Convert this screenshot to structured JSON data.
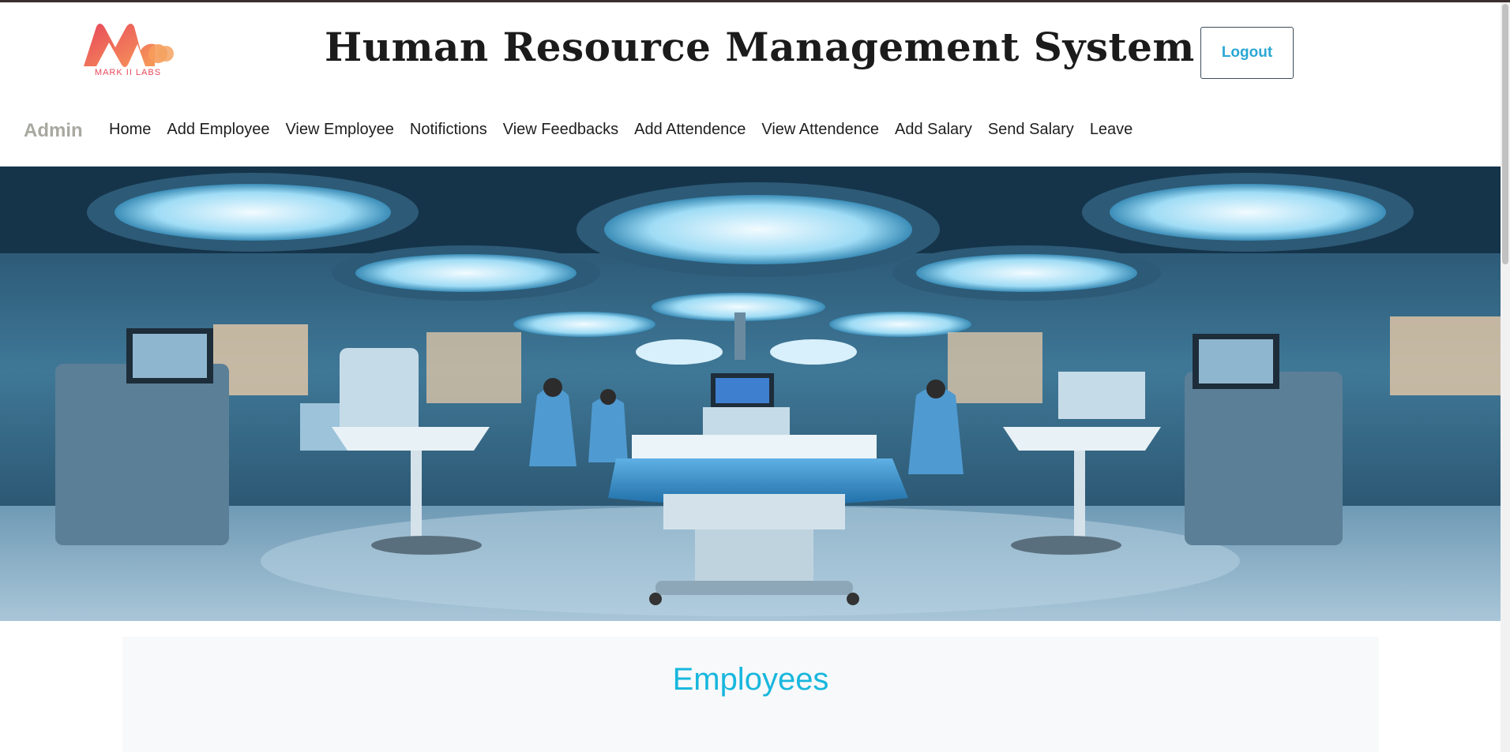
{
  "header": {
    "logo_text": "MARK II LABS",
    "title": "Human Resource Management System",
    "logout_label": "Logout"
  },
  "nav": {
    "brand": "Admin",
    "items": [
      {
        "label": "Home"
      },
      {
        "label": "Add Employee"
      },
      {
        "label": "View Employee"
      },
      {
        "label": "Notifictions"
      },
      {
        "label": "View Feedbacks"
      },
      {
        "label": "Add Attendence"
      },
      {
        "label": "View Attendence"
      },
      {
        "label": "Add Salary"
      },
      {
        "label": "Send Salary"
      },
      {
        "label": "Leave"
      }
    ]
  },
  "hero": {
    "image": "operating-room-photo"
  },
  "section": {
    "title": "Employees"
  },
  "colors": {
    "accent": "#18b7dd",
    "logout_text": "#2aa7d5",
    "logo": "#e8485a"
  }
}
